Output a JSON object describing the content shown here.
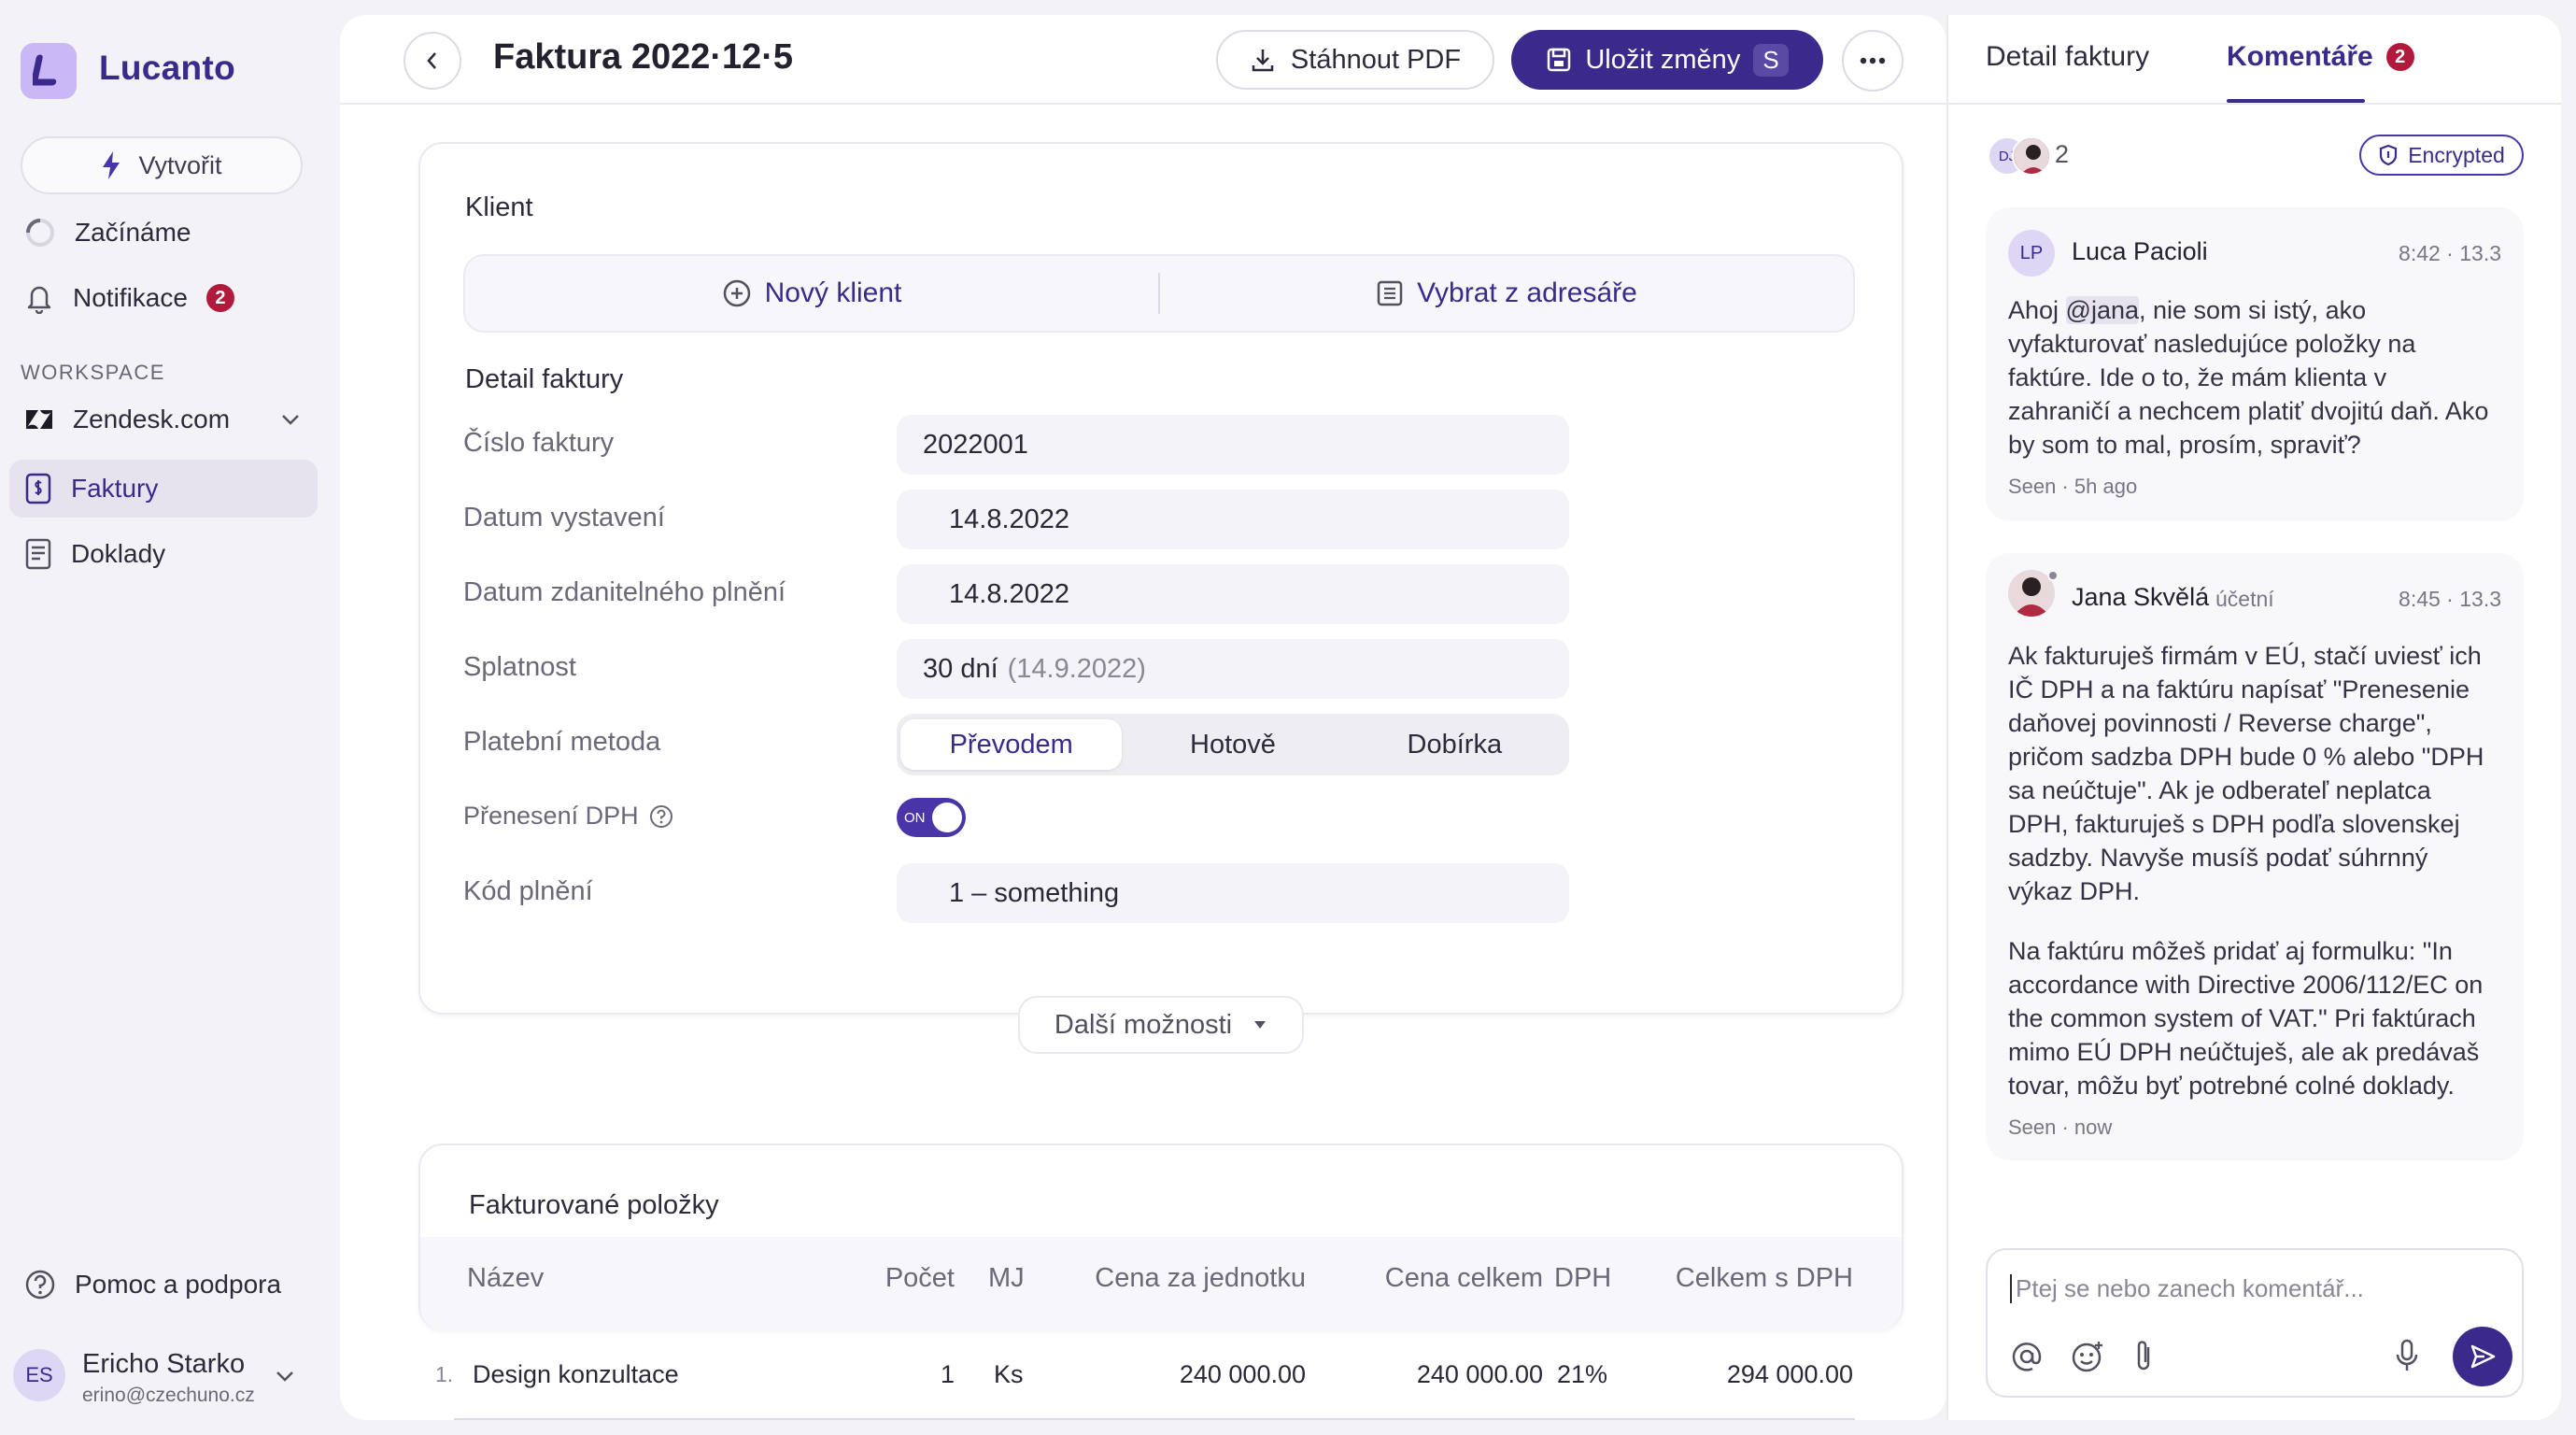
{
  "app": {
    "brand": "Lucanto"
  },
  "sidebar": {
    "create_label": "Vytvořit",
    "items": [
      {
        "label": "Začínáme"
      },
      {
        "label": "Notifikace",
        "badge": "2"
      }
    ],
    "workspace_label": "WORKSPACE",
    "workspace_name": "Zendesk.com",
    "nav": [
      {
        "label": "Faktury",
        "active": true
      },
      {
        "label": "Doklady",
        "active": false
      }
    ],
    "help_label": "Pomoc a podpora",
    "user": {
      "initials": "ES",
      "name": "Ericho Starko",
      "email": "erino@czechuno.cz"
    }
  },
  "header": {
    "title": "Faktura 2022·12·5",
    "pdf_label": "Stáhnout PDF",
    "save_label": "Uložit změny",
    "save_shortcut": "S"
  },
  "client": {
    "title": "Klient",
    "new_label": "Nový klient",
    "select_label": "Vybrat z adresáře"
  },
  "invoice_detail": {
    "title": "Detail faktury",
    "number_label": "Číslo faktury",
    "number_value": "2022001",
    "issue_label": "Datum vystavení",
    "issue_value": "14.8.2022",
    "taxable_label": "Datum zdanitelného plnění",
    "taxable_value": "14.8.2022",
    "due_label": "Splatnost",
    "due_value": "30 dní",
    "due_hint": "(14.9.2022)",
    "payment_label": "Platební metoda",
    "payment_options": [
      "Převodem",
      "Hotově",
      "Dobírka"
    ],
    "payment_selected": "Převodem",
    "vat_label": "Přenesení DPH",
    "vat_toggle": "ON",
    "code_label": "Kód plnění",
    "code_value": "1 – something"
  },
  "more_options_label": "Další možnosti",
  "items": {
    "title": "Fakturované položky",
    "columns": [
      "Název",
      "Počet",
      "MJ",
      "Cena za jednotku",
      "Cena celkem",
      "DPH",
      "Celkem s DPH"
    ],
    "rows": [
      {
        "index": "1.",
        "name": "Design konzultace",
        "count": "1",
        "unit": "Ks",
        "unit_price": "240 000.00",
        "total": "240 000.00",
        "vat": "21%",
        "total_vat": "294 000.00"
      }
    ]
  },
  "panel": {
    "tab_detail": "Detail faktury",
    "tab_comments": "Komentáře",
    "comments_badge": "2",
    "participants_initials": "DJ",
    "participants_count": "2",
    "encrypted_label": "Encrypted",
    "comments": [
      {
        "initials": "LP",
        "author": "Luca Pacioli",
        "role": "",
        "time": "8:42 · 13.3",
        "lines": [
          "Ahoj @jana, nie som si istý, ako",
          "vyfakturovať nasledujúce položky na",
          "faktúre. Ide o to, že mám klienta v",
          "zahraničí a nechcem platiť dvojitú daň. Ako",
          "by som to mal, prosím, spraviť?"
        ],
        "seen": "Seen · 5h ago"
      },
      {
        "initials": "",
        "author": "Jana Skvělá",
        "role": "účetní",
        "time": "8:45 · 13.3",
        "lines": [
          "Ak fakturuješ firmám v EÚ, stačí uviesť ich",
          "IČ DPH a na faktúru napísať \"Prenesenie",
          "daňovej povinnosti / Reverse charge\",",
          "pričom sadzba DPH bude 0 % alebo \"DPH",
          "sa neúčtuje\". Ak je odberateľ neplatca",
          "DPH, fakturuješ s DPH podľa slovenskej",
          "sadzby. Navyše musíš podať súhrnný",
          "výkaz DPH."
        ],
        "lines2": [
          "Na faktúru môžeš pridať aj formulku: \"In",
          "accordance with Directive 2006/112/EC on",
          "the common system of VAT.\" Pri faktúrach",
          "mimo EÚ DPH neúčtuješ, ale ak predávaš",
          "tovar, môžu byť potrebné colné doklady."
        ],
        "seen": "Seen · now"
      }
    ],
    "composer_placeholder": "Ptej se nebo zanech komentář..."
  },
  "colors": {
    "accent": "#3b2a8c",
    "badge": "#b11a3a",
    "background": "#f3f2f6"
  }
}
